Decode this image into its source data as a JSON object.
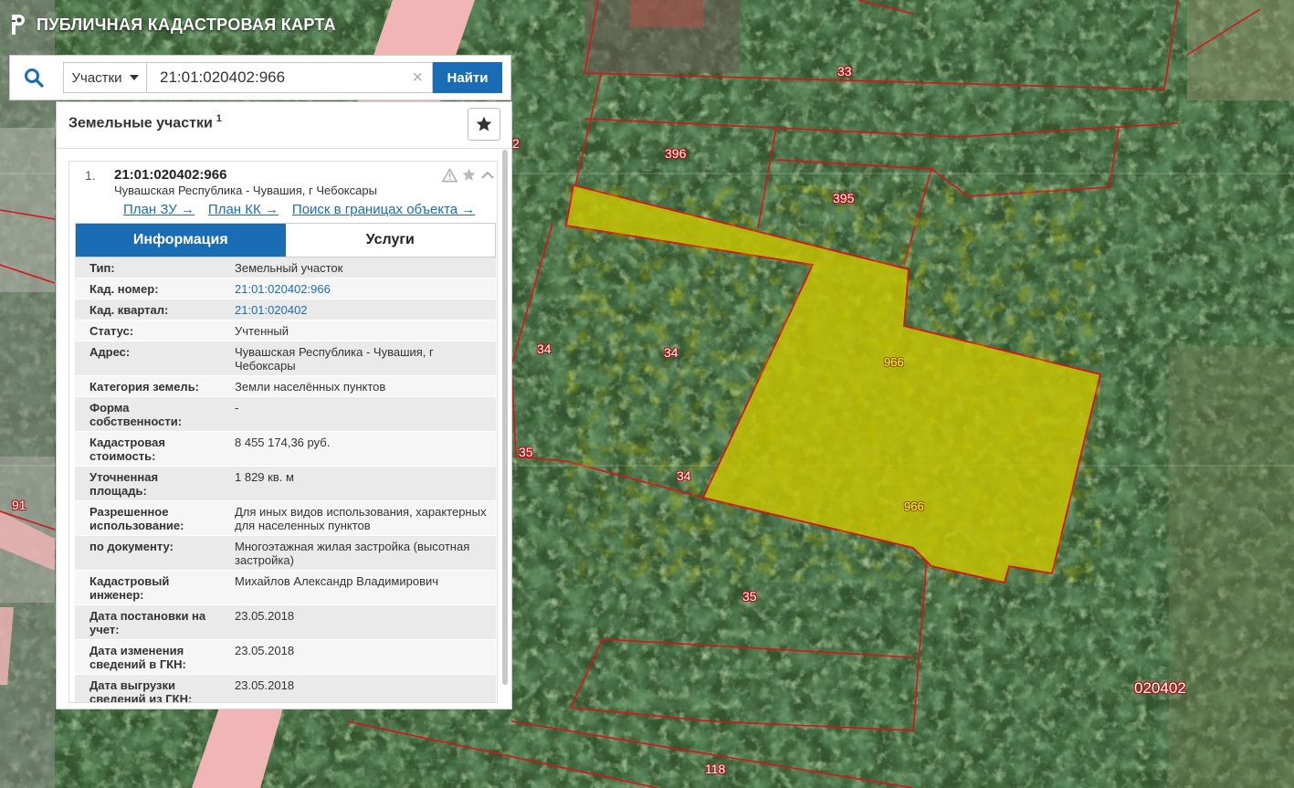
{
  "app": {
    "title": "ПУБЛИЧНАЯ КАДАСТРОВАЯ КАРТА",
    "brand_color": "#1a6cb5"
  },
  "search": {
    "type_label": "Участки",
    "value": "21:01:020402:966",
    "find_label": "Найти"
  },
  "panel": {
    "title": "Земельные участки",
    "count": "1"
  },
  "result": {
    "index": "1.",
    "number": "21:01:020402:966",
    "address": "Чувашская Республика - Чувашия, г Чебоксары",
    "links": [
      "План ЗУ →",
      "План КК →",
      "Поиск в границах объекта →"
    ],
    "tabs": [
      "Информация",
      "Услуги"
    ],
    "fields": [
      {
        "k": "Тип:",
        "v": "Земельный участок"
      },
      {
        "k": "Кад. номер:",
        "v": "21:01:020402:966"
      },
      {
        "k": "Кад. квартал:",
        "v": "21:01:020402"
      },
      {
        "k": "Статус:",
        "v": "Учтенный"
      },
      {
        "k": "Адрес:",
        "v": "Чувашская Республика - Чувашия, г Чебоксары"
      },
      {
        "k": "Категория земель:",
        "v": "Земли населённых пунктов"
      },
      {
        "k": "Форма собственности:",
        "v": "-"
      },
      {
        "k": "Кадастровая стоимость:",
        "v": "8 455 174,36 руб."
      },
      {
        "k": "Уточненная площадь:",
        "v": "1 829 кв. м"
      },
      {
        "k": "Разрешенное использование:",
        "v": "Для иных видов использования, характерных для населенных пунктов"
      },
      {
        "k": "по документу:",
        "v": "Многоэтажная жилая застройка (высотная застройка)"
      },
      {
        "k": "Кадастровый инженер:",
        "v": "Михайлов Александр Владимирович"
      },
      {
        "k": "Дата постановки на учет:",
        "v": "23.05.2018"
      },
      {
        "k": "Дата изменения сведений в ГКН:",
        "v": "23.05.2018"
      },
      {
        "k": "Дата выгрузки сведений из ГКН:",
        "v": "23.05.2018"
      }
    ]
  },
  "map": {
    "labels": [
      "33",
      "396",
      "395",
      "34",
      "34",
      "35",
      "34",
      "966",
      "966",
      "35",
      "91",
      "118",
      "020402",
      "2"
    ],
    "parcel_color": "#c8c400",
    "boundary_color": "#d4151a"
  }
}
